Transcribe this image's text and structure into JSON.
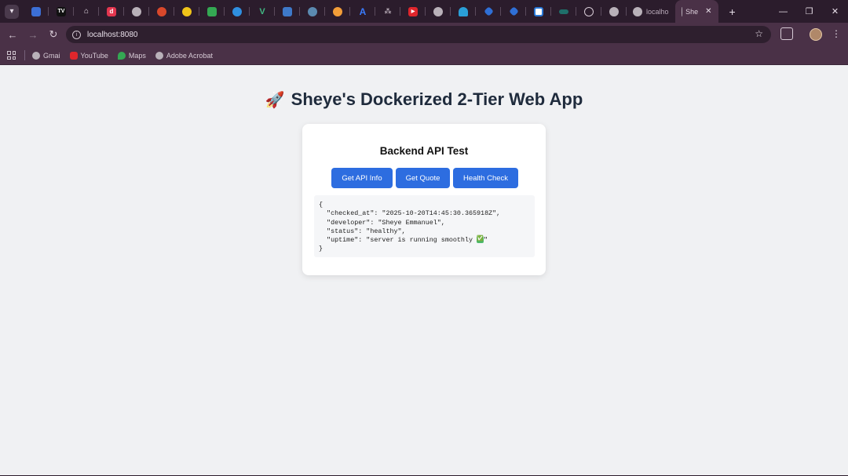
{
  "browser": {
    "tabs": [
      {
        "label": "localho",
        "active": false
      },
      {
        "label": "She",
        "active": true
      }
    ],
    "url": "localhost:8080",
    "bookmarks": [
      {
        "label": "Gmai",
        "icon": "globe-icon"
      },
      {
        "label": "YouTube",
        "icon": "youtube-icon"
      },
      {
        "label": "Maps",
        "icon": "maps-icon"
      },
      {
        "label": "Adobe Acrobat",
        "icon": "globe-icon"
      }
    ]
  },
  "page": {
    "title_emoji": "🚀",
    "title": "Sheye's Dockerized 2-Tier Web App",
    "card_title": "Backend API Test",
    "buttons": {
      "api_info": "Get API Info",
      "quote": "Get Quote",
      "health": "Health Check"
    },
    "json_lines": [
      "{",
      "  \"checked_at\": \"2025-10-20T14:45:30.365918Z\",",
      "  \"developer\": \"Sheye Emmanuel\",",
      "  \"status\": \"healthy\",",
      "  \"uptime\": \"server is running smoothly ",
      "}"
    ],
    "json_check_emoji": "✅",
    "json_line_end": "\""
  },
  "colors": {
    "accent_button": "#2d6de0",
    "title_text": "#1f2b3c",
    "browser_frame": "#4a3147",
    "tab_strip": "#2b1c2c"
  }
}
